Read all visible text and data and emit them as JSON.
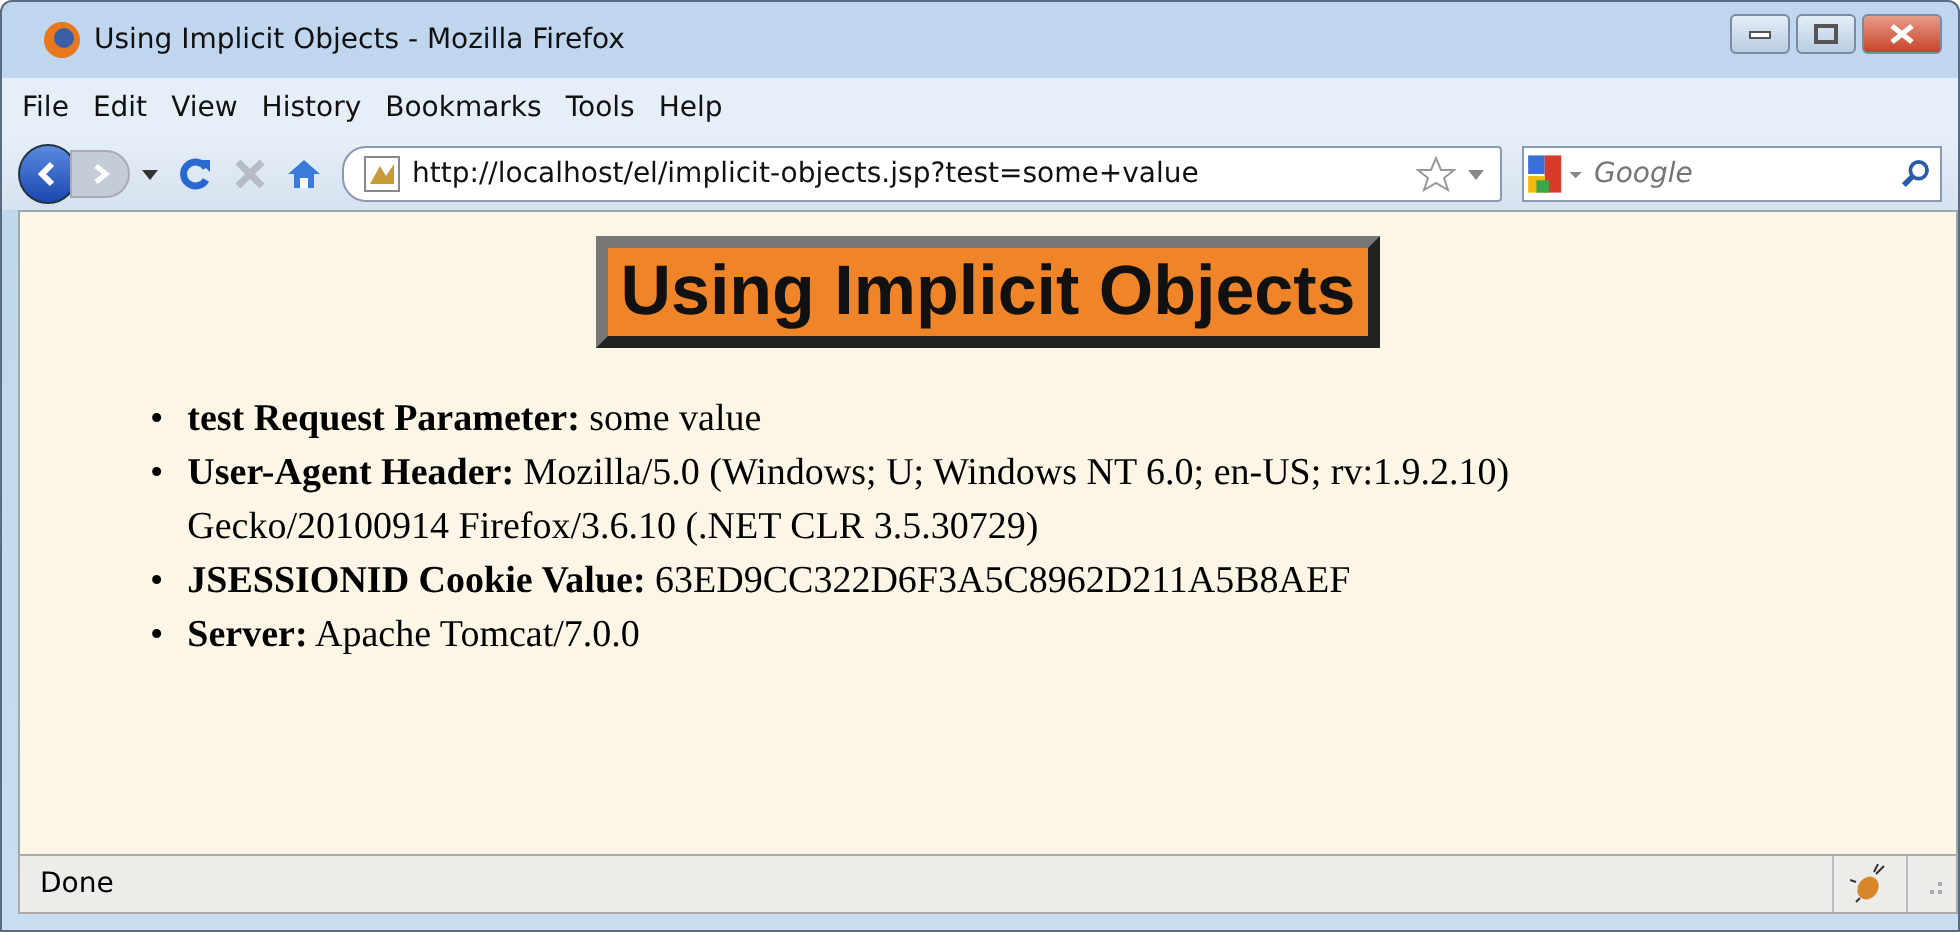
{
  "window": {
    "title": "Using Implicit Objects - Mozilla Firefox"
  },
  "menu": [
    "File",
    "Edit",
    "View",
    "History",
    "Bookmarks",
    "Tools",
    "Help"
  ],
  "address": {
    "value": "http://localhost/el/implicit-objects.jsp?test=some+value"
  },
  "search": {
    "placeholder": "Google"
  },
  "page": {
    "heading": "Using Implicit Objects",
    "items": [
      {
        "bullet": "•",
        "label": "test Request Parameter:",
        "value": "some value"
      },
      {
        "bullet": "•",
        "label": "User-Agent Header:",
        "value": "Mozilla/5.0 (Windows; U; Windows NT 6.0; en-US; rv:1.9.2.10) Gecko/20100914 Firefox/3.6.10 (.NET CLR 3.5.30729)"
      },
      {
        "bullet": "•",
        "label": "JSESSIONID Cookie Value:",
        "value": "63ED9CC322D6F3A5C8962D211A5B8AEF"
      },
      {
        "bullet": "•",
        "label": "Server:",
        "value": "Apache Tomcat/7.0.0"
      }
    ]
  },
  "status_bar": {
    "text": "Done"
  }
}
